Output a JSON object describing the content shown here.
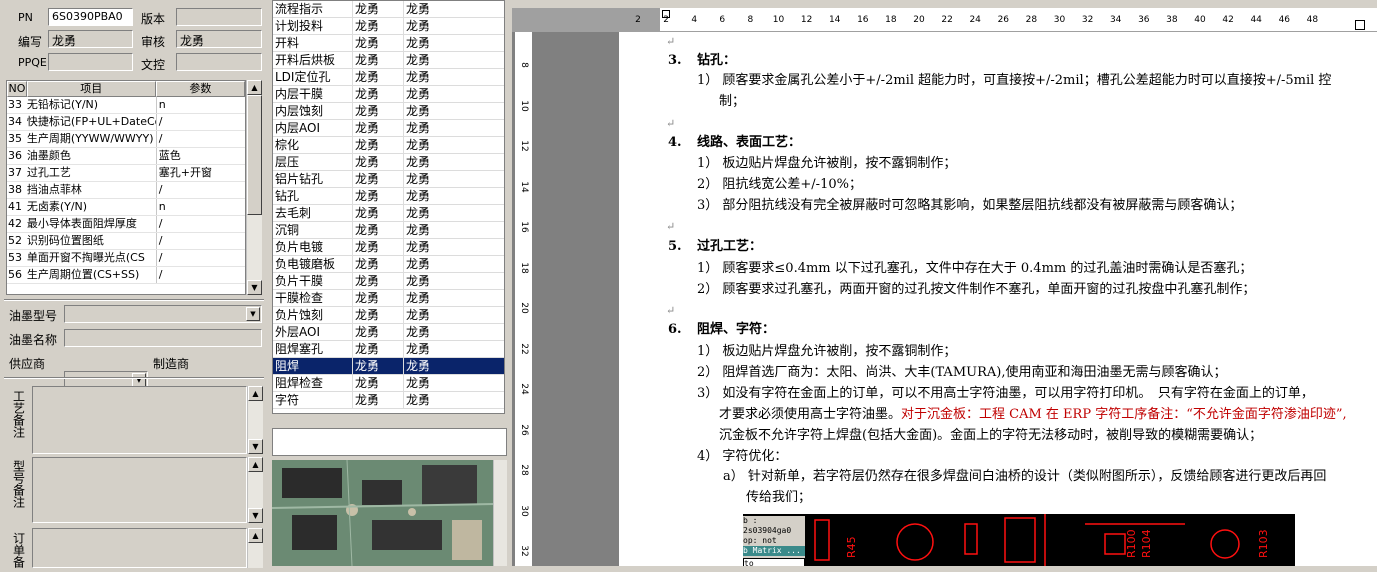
{
  "header_fields": {
    "pn_label": "PN",
    "pn_value": "6S0390PBA0",
    "version_label": "版本",
    "version_value": "",
    "author_label": "编写",
    "author_value": "龙勇",
    "review_label": "审核",
    "review_value": "龙勇",
    "ppqe_label": "PPQE",
    "ppqe_value": "",
    "doc_control_label": "文控",
    "doc_control_value": ""
  },
  "param_table": {
    "headers": [
      "NO",
      "项目",
      "参数"
    ],
    "rows": [
      {
        "no": "33",
        "item": "无铅标记(Y/N)",
        "value": "n"
      },
      {
        "no": "34",
        "item": "快捷标记(FP+UL+DateCo",
        "value": "/"
      },
      {
        "no": "35",
        "item": "生产周期(YYWW/WWYY)",
        "value": "/"
      },
      {
        "no": "36",
        "item": "油墨颜色",
        "value": "蓝色"
      },
      {
        "no": "37",
        "item": "过孔工艺",
        "value": "塞孔+开窗"
      },
      {
        "no": "38",
        "item": "挡油点菲林",
        "value": "/"
      },
      {
        "no": "41",
        "item": "无卤素(Y/N)",
        "value": "n"
      },
      {
        "no": "42",
        "item": "最小导体表面阻焊厚度",
        "value": "/"
      },
      {
        "no": "52",
        "item": "识别码位置图纸",
        "value": "/"
      },
      {
        "no": "53",
        "item": "单面开窗不掏曝光点(CS",
        "value": "/"
      },
      {
        "no": "56",
        "item": "生产周期位置(CS+SS)",
        "value": "/"
      }
    ]
  },
  "ink_fields": {
    "ink_model_label": "油墨型号",
    "ink_name_label": "油墨名称",
    "supplier_label": "供应商",
    "manufacturer_label": "制造商"
  },
  "memos": {
    "process_note_label": "工艺备注",
    "model_note_label": "型号备注",
    "order_note_label": "订单备"
  },
  "flow_table": {
    "rows": [
      {
        "step": "流程指示",
        "a": "龙勇",
        "b": "龙勇"
      },
      {
        "step": "计划投料",
        "a": "龙勇",
        "b": "龙勇"
      },
      {
        "step": "开料",
        "a": "龙勇",
        "b": "龙勇"
      },
      {
        "step": "开料后烘板",
        "a": "龙勇",
        "b": "龙勇"
      },
      {
        "step": "LDI定位孔",
        "a": "龙勇",
        "b": "龙勇"
      },
      {
        "step": "内层干膜",
        "a": "龙勇",
        "b": "龙勇"
      },
      {
        "step": "内层蚀刻",
        "a": "龙勇",
        "b": "龙勇"
      },
      {
        "step": "内层AOI",
        "a": "龙勇",
        "b": "龙勇"
      },
      {
        "step": "棕化",
        "a": "龙勇",
        "b": "龙勇"
      },
      {
        "step": "层压",
        "a": "龙勇",
        "b": "龙勇"
      },
      {
        "step": "铝片钻孔",
        "a": "龙勇",
        "b": "龙勇"
      },
      {
        "step": "钻孔",
        "a": "龙勇",
        "b": "龙勇"
      },
      {
        "step": "去毛刺",
        "a": "龙勇",
        "b": "龙勇"
      },
      {
        "step": "沉铜",
        "a": "龙勇",
        "b": "龙勇"
      },
      {
        "step": "负片电镀",
        "a": "龙勇",
        "b": "龙勇"
      },
      {
        "step": "负电镀磨板",
        "a": "龙勇",
        "b": "龙勇"
      },
      {
        "step": "负片干膜",
        "a": "龙勇",
        "b": "龙勇"
      },
      {
        "step": "干膜检查",
        "a": "龙勇",
        "b": "龙勇"
      },
      {
        "step": "负片蚀刻",
        "a": "龙勇",
        "b": "龙勇"
      },
      {
        "step": "外层AOI",
        "a": "龙勇",
        "b": "龙勇"
      },
      {
        "step": "阻焊塞孔",
        "a": "龙勇",
        "b": "龙勇"
      },
      {
        "step": "阻焊",
        "a": "龙勇",
        "b": "龙勇"
      },
      {
        "step": "阻焊检查",
        "a": "龙勇",
        "b": "龙勇"
      },
      {
        "step": "字符",
        "a": "龙勇",
        "b": "龙勇"
      }
    ],
    "selected_index": 21
  },
  "ruler": {
    "h_ticks": [
      "2",
      "2",
      "4",
      "6",
      "8",
      "10",
      "12",
      "14",
      "16",
      "18",
      "20",
      "22",
      "24",
      "26",
      "28",
      "30",
      "32",
      "34",
      "36",
      "38",
      "40",
      "42",
      "44",
      "46",
      "48"
    ],
    "v_ticks": [
      "8",
      "10",
      "12",
      "14",
      "16",
      "18",
      "20",
      "22",
      "24",
      "26",
      "28",
      "30",
      "32"
    ]
  },
  "document": {
    "s3_num": "3.",
    "s3_title": "钻孔：",
    "s3_p1_a": "1） 顾客要求金属孔公差小于+/-2mil 超能力时，可直接按+/-2mil；槽孔公差超能力时可以直接按+/-5mil 控",
    "s3_p1_b": "制；",
    "s4_num": "4.",
    "s4_title": "线路、表面工艺：",
    "s4_p1": "1） 板边贴片焊盘允许被削，按不露铜制作；",
    "s4_p2": "2） 阻抗线宽公差+/-10%；",
    "s4_p3": "3） 部分阻抗线没有完全被屏蔽时可忽略其影响，如果整层阻抗线都没有被屏蔽需与顾客确认；",
    "s5_num": "5.",
    "s5_title": "过孔工艺：",
    "s5_p1": "1） 顾客要求≤0.4mm 以下过孔塞孔，文件中存在大于 0.4mm 的过孔盖油时需确认是否塞孔；",
    "s5_p2": "2） 顾客要求过孔塞孔，两面开窗的过孔按文件制作不塞孔，单面开窗的过孔按盘中孔塞孔制作；",
    "s6_num": "6.",
    "s6_title": "阻焊、字符：",
    "s6_p1": "1） 板边贴片焊盘允许被削，按不露铜制作；",
    "s6_p2": "2） 阻焊首选厂商为：太阳、尚洪、大丰(TAMURA),使用南亚和海田油墨无需与顾客确认；",
    "s6_p3_a": "3） 如没有字符在金面上的订单，可以不用高士字符油墨，可以用字符打印机。　只有字符在金面上的订单，",
    "s6_p3_b1": "才要求必须使用高士字符油墨。",
    "s6_p3_b2": "对于沉金板：工程 CAM 在 ERP 字符工序备注：“不允许金面字符渗油印迹”,",
    "s6_p3_c": "沉金板不允许字符上焊盘(包括大金面)。金面上的字符无法移动时，被削导致的模糊需要确认；",
    "s6_p4": "4） 字符优化：",
    "s6_p4a_a": "a） 针对新单，若字符层仍然存在很多焊盘间白油桥的设计（类似附图所示），反馈给顾客进行更改后再回",
    "s6_p4a_b": "传给我们；",
    "ret": "↵",
    "img_line1": "b : 2s03904ga0",
    "img_line2": "op: not",
    "img_line3": "b Matrix ...",
    "img_line4": "to",
    "img_silk": [
      "R104",
      "R100",
      "R103",
      "R45"
    ]
  }
}
